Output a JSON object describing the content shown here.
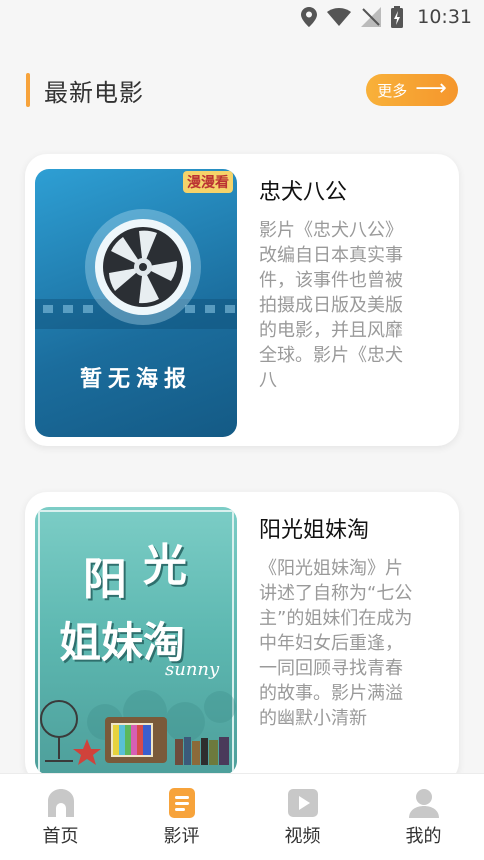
{
  "status_bar": {
    "time": "10:31"
  },
  "section": {
    "title": "最新电影",
    "more_label": "更多",
    "more_arrow": "⟶"
  },
  "movies": [
    {
      "title": "忠犬八公",
      "description": "影片《忠犬八公》改编自日本真实事件，该事件也曾被拍摄成日版及美版的电影，并且风靡全球。影片《忠犬八",
      "poster": {
        "logo_text": "漫漫看",
        "placeholder_text": "暂无海报"
      }
    },
    {
      "title": "阳光姐妹淘",
      "description": "《阳光姐妹淘》片讲述了自称为“七公主”的姐妹们在成为中年妇女后重逢，一同回顾寻找青春的故事。影片满溢的幽默小清新",
      "poster": {
        "title_line1_a": "阳",
        "title_line1_b": "光",
        "title_line2": "姐妹淘",
        "subtitle": "sunny"
      }
    }
  ],
  "nav": [
    {
      "label": "首页",
      "icon": "home-icon",
      "active": false
    },
    {
      "label": "影评",
      "icon": "review-icon",
      "active": true
    },
    {
      "label": "视频",
      "icon": "video-icon",
      "active": false
    },
    {
      "label": "我的",
      "icon": "profile-icon",
      "active": false
    }
  ],
  "colors": {
    "accent": "#f7a33b",
    "icon_gray": "#c8c8c8",
    "background": "#f6f6f6"
  }
}
